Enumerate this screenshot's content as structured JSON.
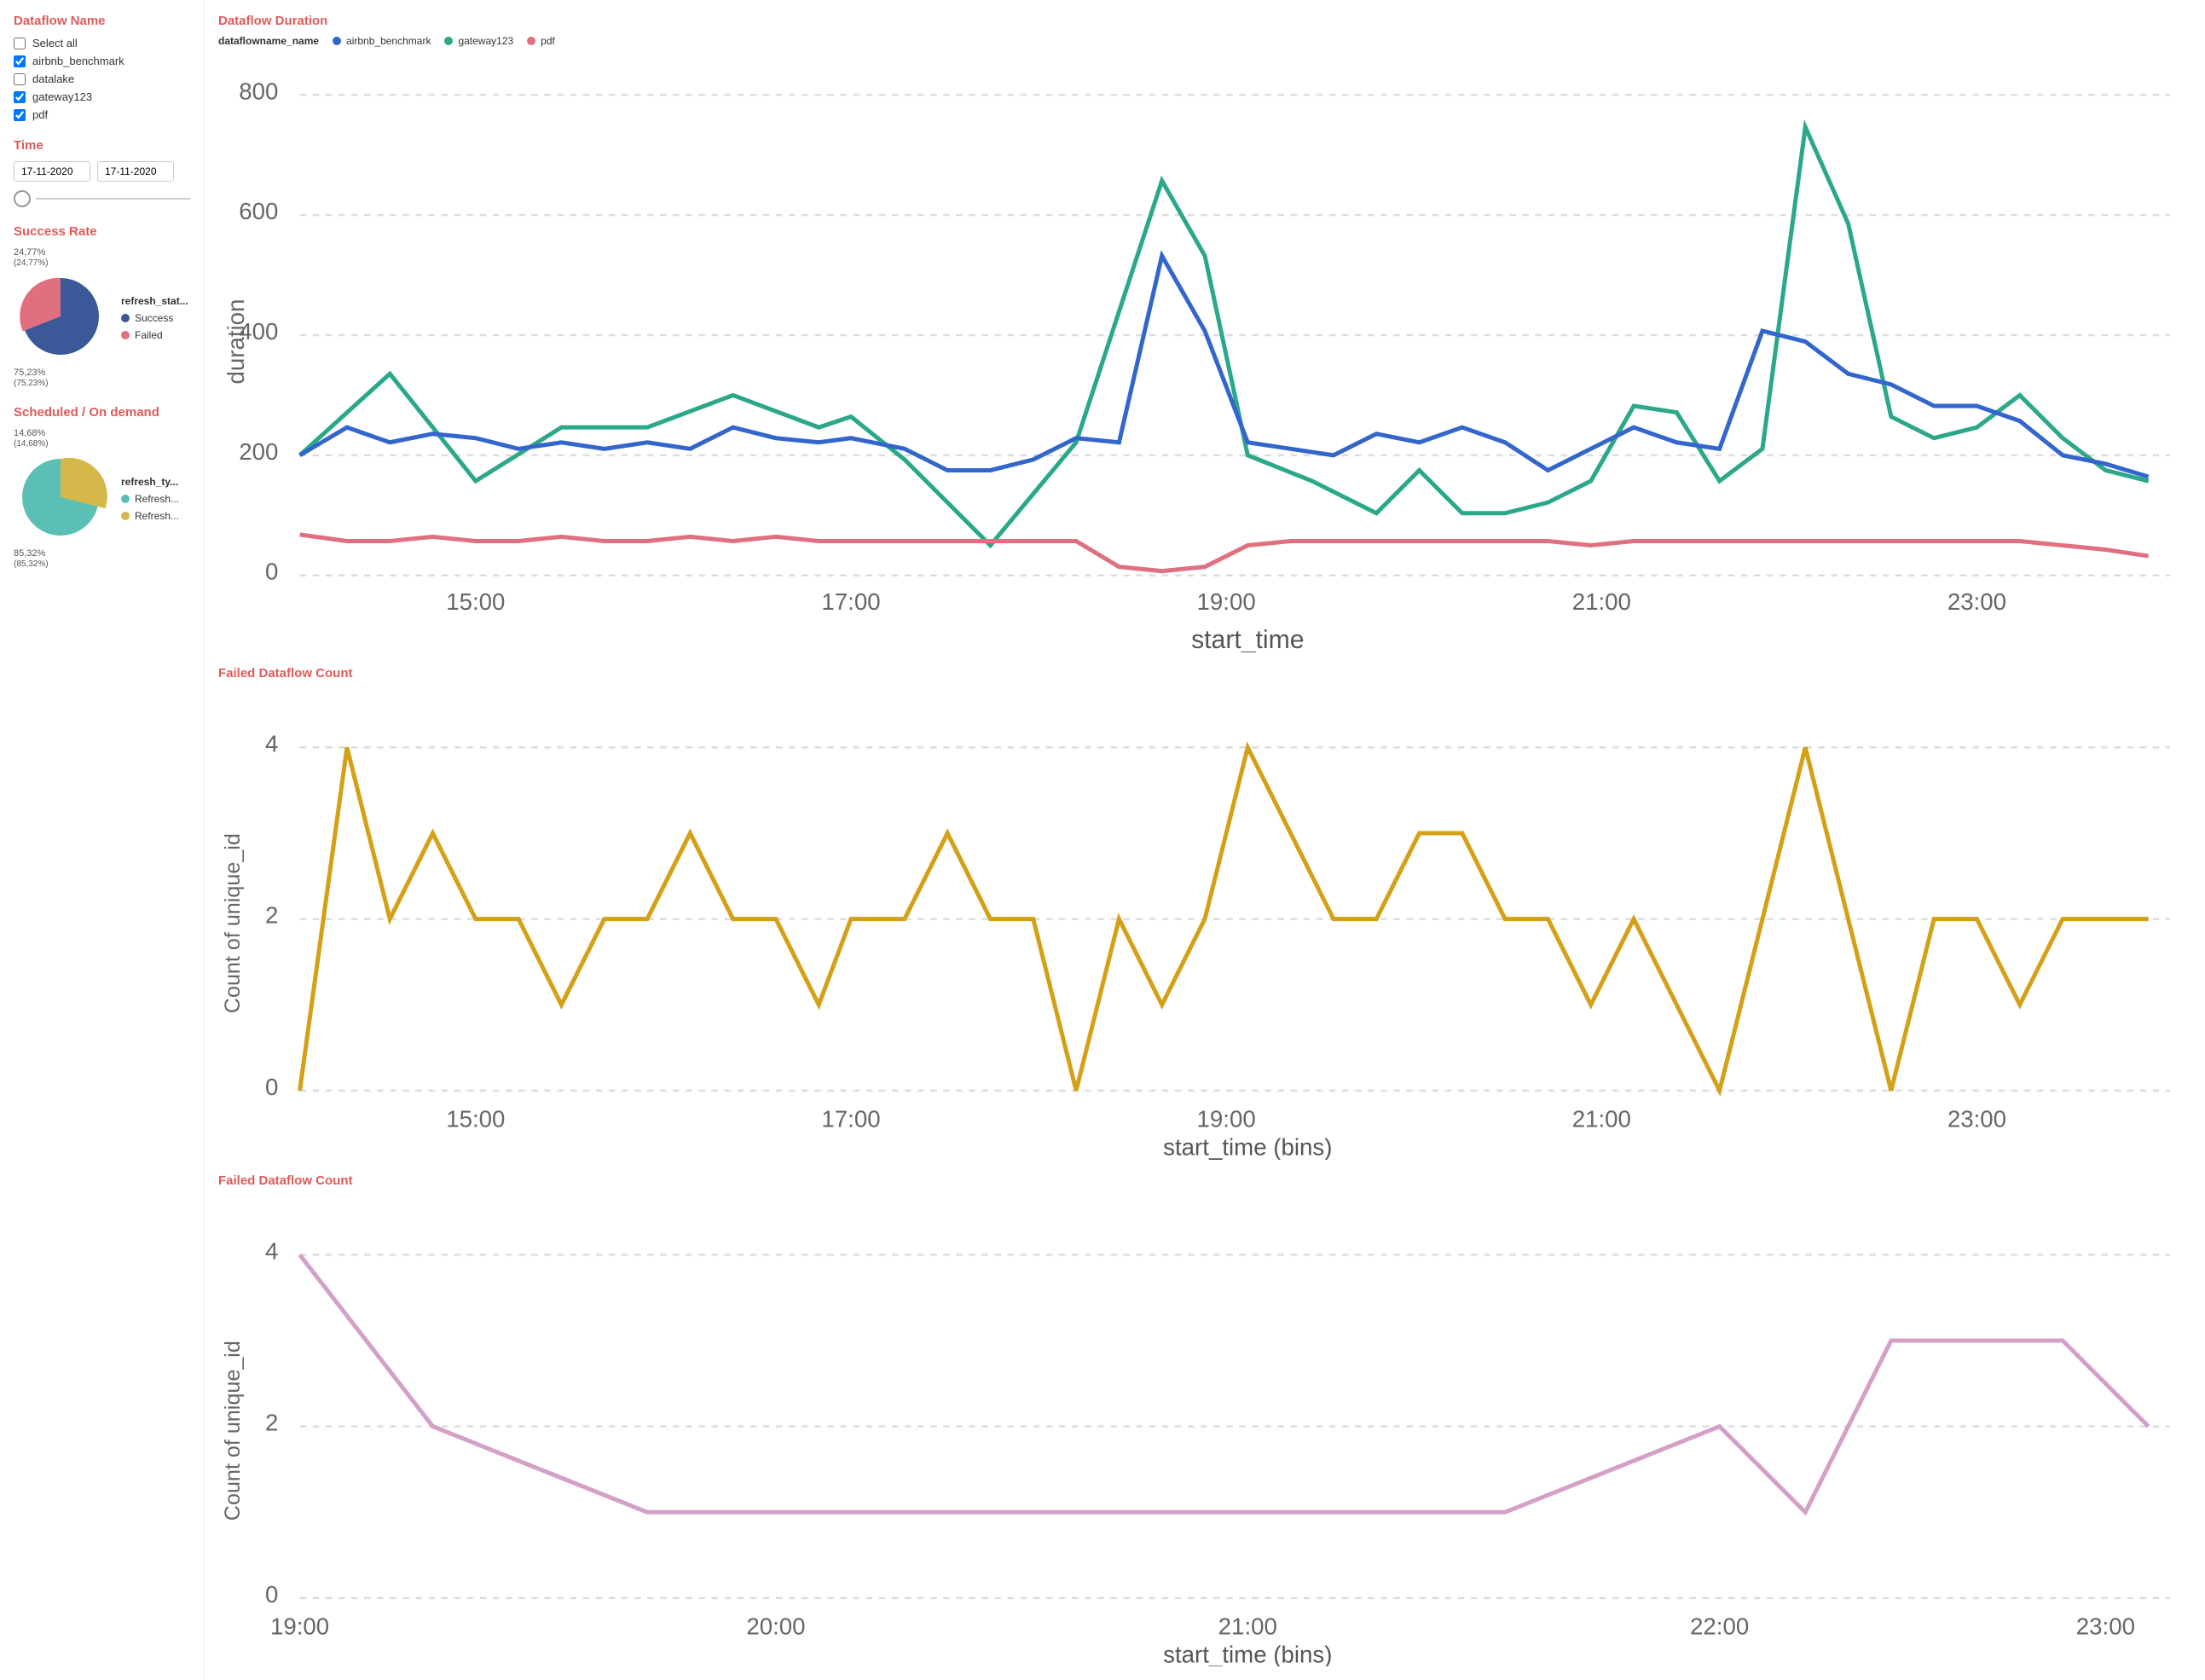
{
  "sidebar": {
    "dataflow_section_title": "Dataflow Name",
    "time_section_title": "Time",
    "checkboxes": [
      {
        "label": "Select all",
        "checked": false,
        "id": "cb-select-all"
      },
      {
        "label": "airbnb_benchmark",
        "checked": true,
        "id": "cb-airbnb"
      },
      {
        "label": "datalake",
        "checked": false,
        "id": "cb-datalake"
      },
      {
        "label": "gateway123",
        "checked": true,
        "id": "cb-gateway"
      },
      {
        "label": "pdf",
        "checked": true,
        "id": "cb-pdf"
      }
    ],
    "date_from": "17-11-2020",
    "date_to": "17-11-2020"
  },
  "success_rate": {
    "title": "Success Rate",
    "legend_title": "refresh_stat...",
    "segments": [
      {
        "label": "Success",
        "color": "#3b5998",
        "value": 75.23,
        "display": "75,23%\n(75,23%)"
      },
      {
        "label": "Failed",
        "color": "#e07080",
        "value": 24.77,
        "display": "24,77%\n(24,77%)"
      }
    ]
  },
  "scheduled": {
    "title": "Scheduled / On demand",
    "legend_title": "refresh_ty...",
    "segments": [
      {
        "label": "Refresh...",
        "color": "#5bbfb5",
        "value": 85.32,
        "display": "85,32%\n(85,32%)"
      },
      {
        "label": "Refresh...",
        "color": "#d4b84a",
        "value": 14.68,
        "display": "14,68%\n(14,68%)"
      }
    ]
  },
  "duration_chart": {
    "title": "Dataflow Duration",
    "legend_title": "dataflowname_name",
    "series": [
      {
        "name": "airbnb_benchmark",
        "color": "#3366cc"
      },
      {
        "name": "gateway123",
        "color": "#2ba88a"
      },
      {
        "name": "pdf",
        "color": "#e07080"
      }
    ],
    "x_label": "start_time",
    "y_label": "duration",
    "x_ticks": [
      "15:00",
      "17:00",
      "19:00",
      "21:00",
      "23:00"
    ],
    "y_ticks": [
      "0",
      "200",
      "400",
      "600",
      "800"
    ]
  },
  "failed_count_chart1": {
    "title": "Failed Dataflow Count",
    "color": "#d4a017",
    "x_label": "start_time (bins)",
    "y_label": "Count of unique_id",
    "x_ticks": [
      "15:00",
      "17:00",
      "19:00",
      "21:00",
      "23:00"
    ],
    "y_ticks": [
      "0",
      "2",
      "4"
    ]
  },
  "failed_count_chart2": {
    "title": "Failed Dataflow Count",
    "color": "#d4a0c8",
    "x_label": "start_time (bins)",
    "y_label": "Count of unique_id",
    "x_ticks": [
      "19:00",
      "20:00",
      "21:00",
      "22:00",
      "23:00"
    ],
    "y_ticks": [
      "0",
      "2",
      "4"
    ]
  }
}
